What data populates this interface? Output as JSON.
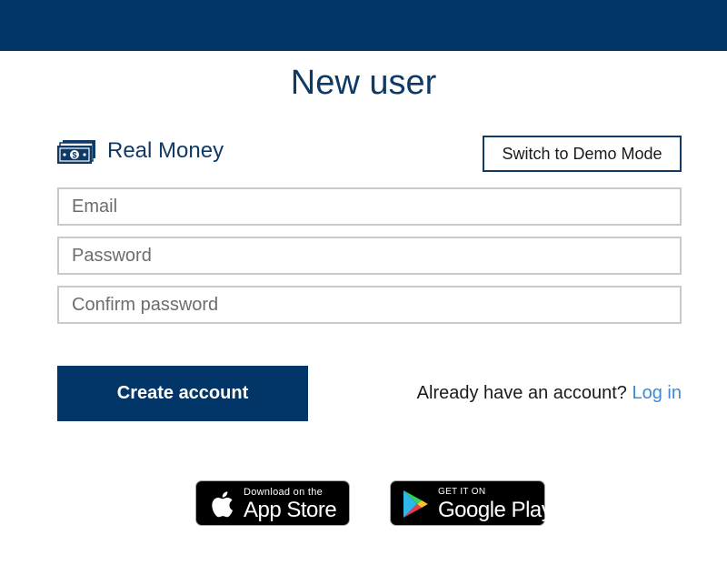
{
  "header": {
    "title": "New user"
  },
  "mode": {
    "icon": "money-icon",
    "label": "Real Money",
    "switch_button": "Switch to Demo Mode"
  },
  "form": {
    "email_placeholder": "Email",
    "password_placeholder": "Password",
    "confirm_placeholder": "Confirm password",
    "submit_label": "Create account"
  },
  "login": {
    "prompt": "Already have an account?",
    "link": "Log in"
  },
  "stores": {
    "apple": {
      "icon": "apple-icon",
      "small": "Download on the",
      "big": "App Store"
    },
    "google": {
      "icon": "google-play-icon",
      "small": "GET IT ON",
      "big": "Google Play"
    }
  },
  "colors": {
    "brand": "#033668",
    "link": "#3d8ad9",
    "field_border": "#c9c9c9"
  }
}
